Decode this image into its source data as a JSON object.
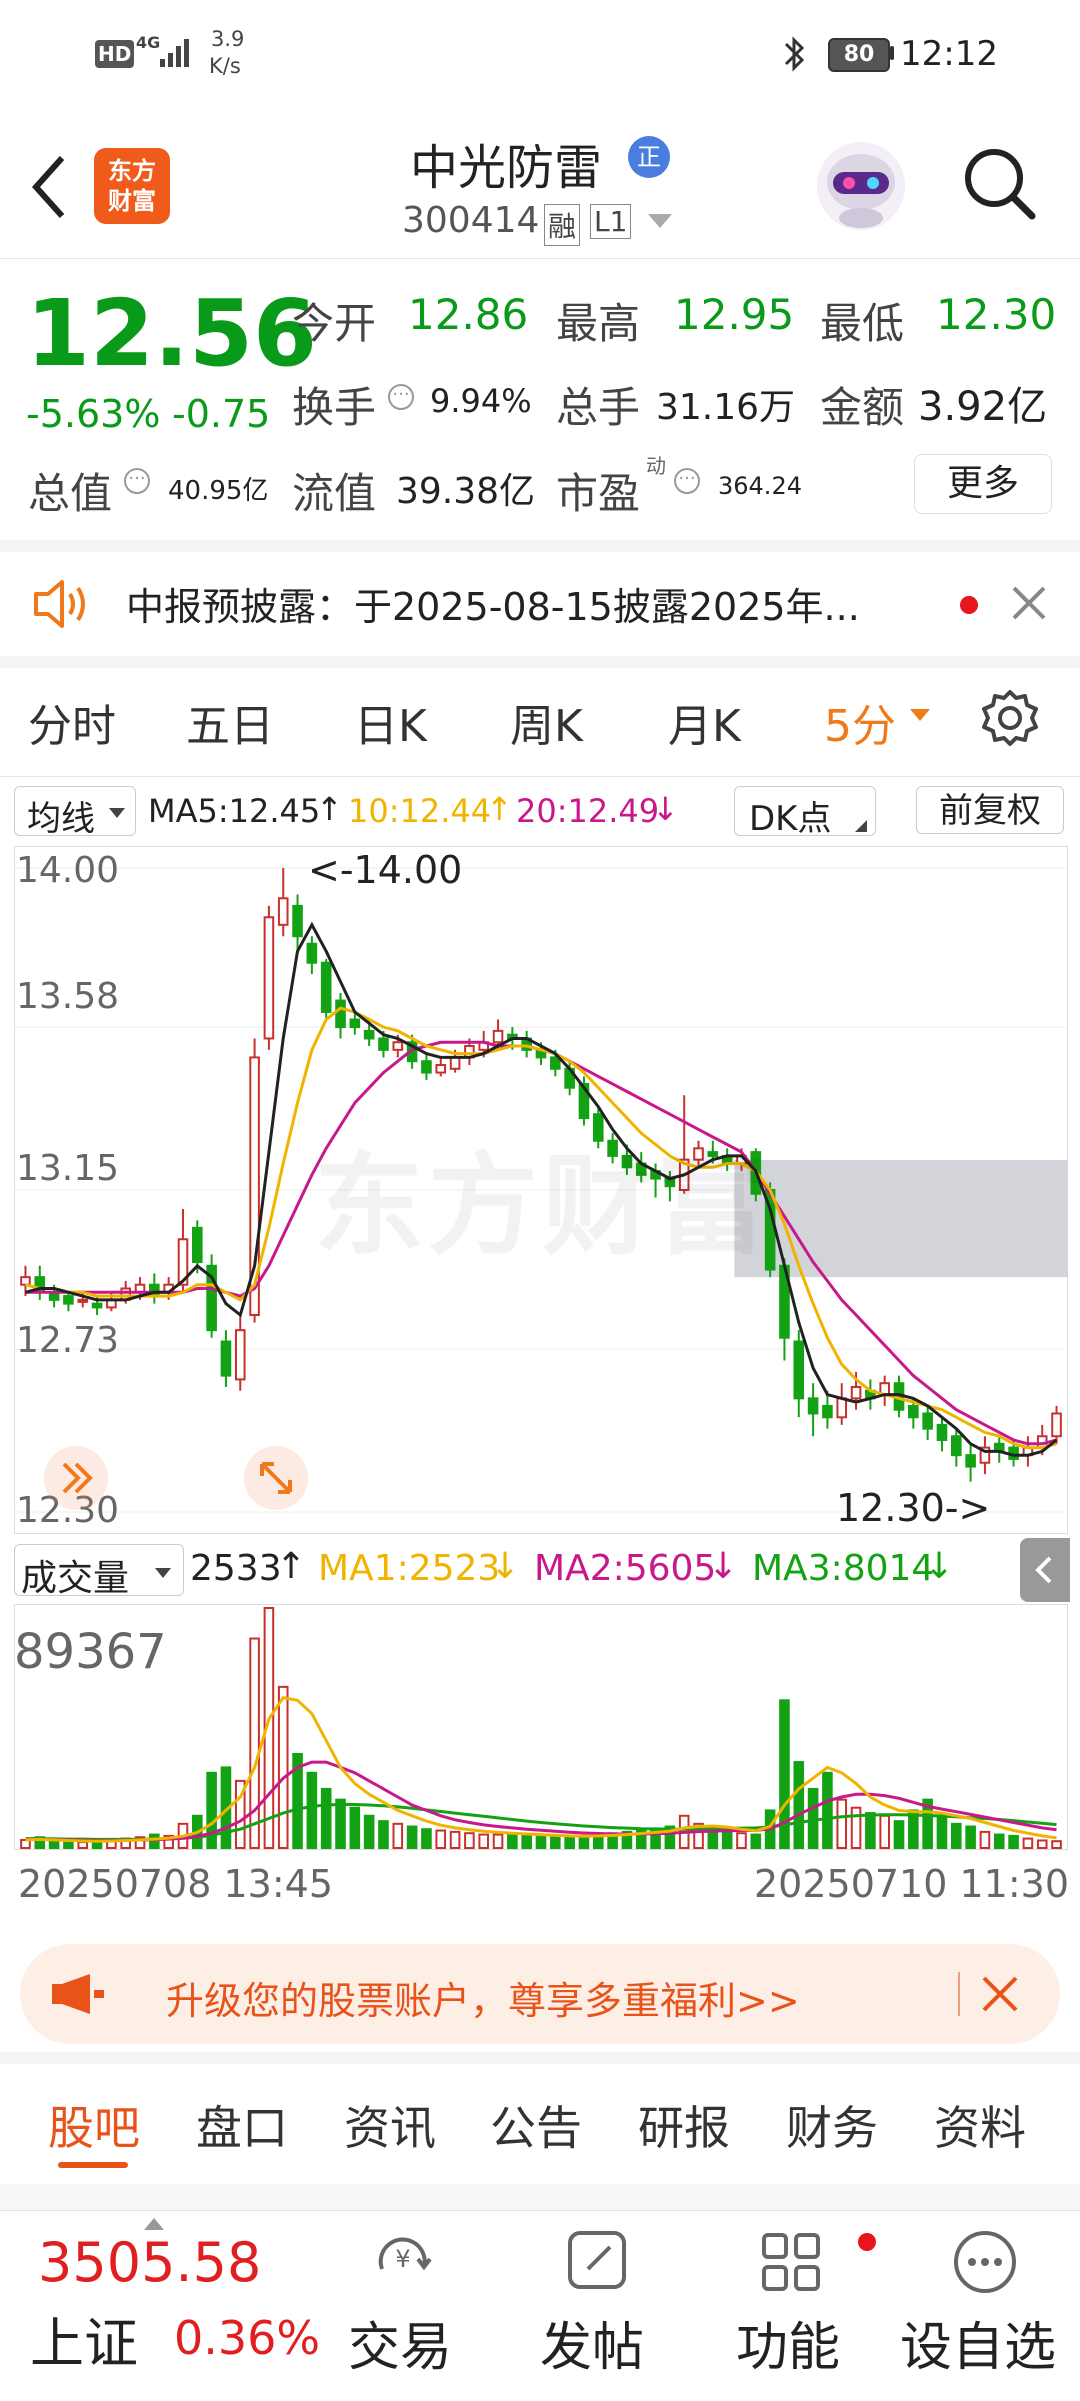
{
  "status_bar": {
    "net_speed": "3.9",
    "net_unit": "K/s",
    "battery": "80",
    "time": "12:12",
    "hd": "HD",
    "signal": "4G"
  },
  "header": {
    "logo_line1": "东方",
    "logo_line2": "财富",
    "stock_name": "中光防雷",
    "badge": "正",
    "code": "300414",
    "tag1": "融",
    "tag2": "L1"
  },
  "quote": {
    "price": "12.56",
    "pct": "-5.63%",
    "change": "-0.75",
    "open_label": "今开",
    "open": "12.86",
    "high_label": "最高",
    "high": "12.95",
    "low_label": "最低",
    "low": "12.30",
    "turnover_label": "换手",
    "turnover": "9.94%",
    "volume_label": "总手",
    "volume": "31.16万",
    "amount_label": "金额",
    "amount": "3.92亿",
    "mcap_label": "总值",
    "mcap": "40.95亿",
    "float_label": "流值",
    "float": "39.38亿",
    "pe_label": "市盈",
    "pe_sup": "动",
    "pe": "364.24",
    "more": "更多"
  },
  "notice": {
    "text": "中报预披露：于2025-08-15披露2025年..."
  },
  "period_tabs": {
    "t1": "分时",
    "t2": "五日",
    "t3": "日K",
    "t4": "周K",
    "t5": "月K",
    "t6": "5分"
  },
  "ma_bar": {
    "selector": "均线",
    "ma5": "MA5:12.45",
    "ma10": "10:12.44",
    "ma20": "20:12.49",
    "dk": "DK点",
    "fq": "前复权"
  },
  "chart_data": {
    "type": "candlestick",
    "y_ticks": [
      "14.00",
      "13.58",
      "13.15",
      "12.73",
      "12.30"
    ],
    "ylim": [
      12.3,
      14.0
    ],
    "high_marker": "<-14.00",
    "low_marker": "12.30->",
    "watermark": "东方财富",
    "opens": [
      12.9,
      12.92,
      12.88,
      12.87,
      12.86,
      12.85,
      12.84,
      12.86,
      12.88,
      12.9,
      12.88,
      12.9,
      13.05,
      12.95,
      12.75,
      12.65,
      12.82,
      13.55,
      13.85,
      13.9,
      13.8,
      13.75,
      13.65,
      13.6,
      13.57,
      13.55,
      13.52,
      13.54,
      13.49,
      13.46,
      13.47,
      13.5,
      13.52,
      13.54,
      13.56,
      13.55,
      13.52,
      13.5,
      13.47,
      13.43,
      13.35,
      13.28,
      13.24,
      13.22,
      13.2,
      13.18,
      13.15,
      13.23,
      13.25,
      13.24,
      13.22,
      13.25,
      13.15,
      12.95,
      12.75,
      12.6,
      12.58,
      12.55,
      12.6,
      12.62,
      12.61,
      12.64,
      12.58,
      12.56,
      12.53,
      12.5,
      12.45,
      12.43,
      12.48,
      12.47,
      12.45,
      12.47,
      12.5
    ],
    "closes": [
      12.92,
      12.88,
      12.86,
      12.85,
      12.86,
      12.84,
      12.86,
      12.89,
      12.9,
      12.87,
      12.9,
      13.02,
      12.96,
      12.78,
      12.66,
      12.78,
      13.5,
      13.87,
      13.92,
      13.82,
      13.75,
      13.62,
      13.58,
      13.58,
      13.55,
      13.52,
      13.54,
      13.49,
      13.46,
      13.48,
      13.5,
      13.53,
      13.54,
      13.57,
      13.55,
      13.52,
      13.5,
      13.47,
      13.42,
      13.34,
      13.28,
      13.24,
      13.21,
      13.19,
      13.18,
      13.16,
      13.23,
      13.26,
      13.24,
      13.22,
      13.24,
      13.14,
      12.94,
      12.76,
      12.6,
      12.56,
      12.55,
      12.6,
      12.63,
      12.6,
      12.64,
      12.57,
      12.55,
      12.52,
      12.49,
      12.45,
      12.42,
      12.47,
      12.46,
      12.44,
      12.47,
      12.5,
      12.56
    ],
    "highs": [
      12.95,
      12.95,
      12.9,
      12.88,
      12.88,
      12.87,
      12.88,
      12.91,
      12.92,
      12.93,
      12.92,
      13.1,
      13.07,
      12.98,
      12.78,
      12.82,
      13.55,
      13.9,
      14.0,
      13.93,
      13.82,
      13.76,
      13.67,
      13.62,
      13.6,
      13.57,
      13.56,
      13.56,
      13.51,
      13.5,
      13.52,
      13.55,
      13.57,
      13.6,
      13.58,
      13.57,
      13.54,
      13.52,
      13.49,
      13.45,
      13.37,
      13.3,
      13.27,
      13.25,
      13.22,
      13.2,
      13.4,
      13.28,
      13.28,
      13.26,
      13.26,
      13.26,
      13.17,
      12.97,
      12.78,
      12.64,
      12.62,
      12.64,
      12.67,
      12.65,
      12.66,
      12.66,
      12.6,
      12.58,
      12.55,
      12.52,
      12.48,
      12.5,
      12.5,
      12.49,
      12.5,
      12.53,
      12.58
    ],
    "lows": [
      12.87,
      12.86,
      12.84,
      12.83,
      12.84,
      12.82,
      12.83,
      12.85,
      12.86,
      12.85,
      12.86,
      12.88,
      12.93,
      12.76,
      12.63,
      12.62,
      12.8,
      13.52,
      13.82,
      13.78,
      13.72,
      13.6,
      13.55,
      13.56,
      13.53,
      13.5,
      13.5,
      13.47,
      13.44,
      13.45,
      13.46,
      13.48,
      13.5,
      13.52,
      13.52,
      13.5,
      13.48,
      13.45,
      13.4,
      13.32,
      13.26,
      13.22,
      13.19,
      13.17,
      13.13,
      13.12,
      13.14,
      13.21,
      13.22,
      13.2,
      13.2,
      13.12,
      12.92,
      12.7,
      12.55,
      12.5,
      12.52,
      12.53,
      12.57,
      12.57,
      12.58,
      12.55,
      12.52,
      12.49,
      12.46,
      12.42,
      12.38,
      12.4,
      12.43,
      12.42,
      12.42,
      12.45,
      12.48
    ],
    "ma5": [
      12.88,
      12.89,
      12.89,
      12.88,
      12.87,
      12.86,
      12.86,
      12.86,
      12.87,
      12.88,
      12.88,
      12.91,
      12.95,
      12.92,
      12.85,
      12.82,
      12.95,
      13.25,
      13.55,
      13.78,
      13.85,
      13.78,
      13.7,
      13.62,
      13.59,
      13.56,
      13.55,
      13.53,
      13.51,
      13.5,
      13.5,
      13.5,
      13.51,
      13.53,
      13.55,
      13.55,
      13.53,
      13.51,
      13.47,
      13.42,
      13.37,
      13.31,
      13.26,
      13.22,
      13.2,
      13.18,
      13.19,
      13.21,
      13.23,
      13.24,
      13.24,
      13.2,
      13.1,
      12.95,
      12.8,
      12.68,
      12.61,
      12.6,
      12.59,
      12.6,
      12.61,
      12.61,
      12.6,
      12.58,
      12.55,
      12.52,
      12.48,
      12.46,
      12.46,
      12.45,
      12.45,
      12.46,
      12.49
    ],
    "ma10": [
      12.9,
      12.89,
      12.89,
      12.88,
      12.88,
      12.87,
      12.87,
      12.87,
      12.87,
      12.87,
      12.87,
      12.88,
      12.9,
      12.9,
      12.88,
      12.86,
      12.9,
      13.05,
      13.22,
      13.38,
      13.52,
      13.6,
      13.63,
      13.62,
      13.6,
      13.58,
      13.57,
      13.55,
      13.53,
      13.52,
      13.51,
      13.51,
      13.51,
      13.52,
      13.53,
      13.53,
      13.52,
      13.51,
      13.49,
      13.46,
      13.42,
      13.38,
      13.34,
      13.3,
      13.27,
      13.24,
      13.22,
      13.21,
      13.21,
      13.22,
      13.22,
      13.2,
      13.15,
      13.06,
      12.95,
      12.85,
      12.76,
      12.69,
      12.65,
      12.62,
      12.61,
      12.6,
      12.59,
      12.58,
      12.57,
      12.55,
      12.53,
      12.51,
      12.5,
      12.48,
      12.47,
      12.47,
      12.48
    ],
    "ma20": [
      12.88,
      12.88,
      12.88,
      12.88,
      12.88,
      12.88,
      12.88,
      12.88,
      12.88,
      12.88,
      12.88,
      12.88,
      12.89,
      12.89,
      12.88,
      12.87,
      12.89,
      12.95,
      13.03,
      13.11,
      13.19,
      13.26,
      13.32,
      13.38,
      13.42,
      13.46,
      13.49,
      13.52,
      13.53,
      13.54,
      13.54,
      13.54,
      13.54,
      13.53,
      13.53,
      13.53,
      13.52,
      13.51,
      13.49,
      13.47,
      13.45,
      13.43,
      13.41,
      13.39,
      13.37,
      13.35,
      13.33,
      13.31,
      13.29,
      13.27,
      13.25,
      13.2,
      13.14,
      13.08,
      13.02,
      12.96,
      12.91,
      12.86,
      12.82,
      12.78,
      12.74,
      12.7,
      12.66,
      12.63,
      12.6,
      12.57,
      12.55,
      12.53,
      12.51,
      12.49,
      12.48,
      12.48,
      12.49
    ]
  },
  "volume_bar": {
    "selector": "成交量",
    "current": "2533",
    "ma1": "MA1:2523",
    "ma2": "MA2:5605",
    "ma3": "MA3:8014",
    "max_label": "89367"
  },
  "volume_data": {
    "max": 89367,
    "values": [
      3000,
      4000,
      2500,
      2000,
      2200,
      2500,
      3000,
      3500,
      4000,
      5000,
      4500,
      9000,
      12000,
      28000,
      30000,
      25000,
      78000,
      89367,
      60000,
      35000,
      28000,
      22000,
      18000,
      15000,
      12000,
      10000,
      9000,
      8000,
      7000,
      6500,
      6000,
      5500,
      5000,
      5000,
      5000,
      4500,
      4500,
      4000,
      4000,
      4500,
      5000,
      5500,
      6000,
      6500,
      7000,
      8000,
      12000,
      9000,
      7000,
      6000,
      5500,
      5000,
      14000,
      55000,
      32000,
      22000,
      28000,
      18000,
      15000,
      13000,
      12000,
      10000,
      14000,
      18000,
      12000,
      9000,
      8000,
      6000,
      5000,
      4500,
      3500,
      2800,
      2533
    ],
    "ma1": [
      3000,
      3200,
      3000,
      2800,
      2600,
      2500,
      2600,
      2800,
      3000,
      3300,
      3700,
      4400,
      5800,
      9000,
      14000,
      19000,
      30000,
      48000,
      56000,
      55000,
      50000,
      40000,
      30000,
      24000,
      20000,
      17000,
      14000,
      12000,
      10000,
      8500,
      7500,
      6800,
      6200,
      5800,
      5500,
      5200,
      5000,
      4700,
      4500,
      4400,
      4500,
      4700,
      5000,
      5400,
      5800,
      6300,
      7500,
      8000,
      8200,
      7800,
      7000,
      6400,
      8000,
      16000,
      22000,
      26000,
      30000,
      28000,
      24000,
      19000,
      16000,
      14000,
      13500,
      13500,
      13000,
      12000,
      11000,
      9500,
      8000,
      6500,
      5500,
      4500,
      3800
    ],
    "ma2": [
      3200,
      3200,
      3100,
      3000,
      2900,
      2800,
      2800,
      2900,
      3000,
      3100,
      3300,
      3700,
      4300,
      5500,
      7500,
      10000,
      14000,
      20000,
      26000,
      30000,
      32000,
      32000,
      30000,
      28000,
      25000,
      22000,
      19000,
      16000,
      14000,
      12000,
      10500,
      9500,
      8600,
      8000,
      7500,
      7000,
      6600,
      6200,
      5900,
      5600,
      5400,
      5200,
      5200,
      5200,
      5300,
      5500,
      5800,
      6100,
      6300,
      6400,
      6500,
      6500,
      7200,
      9500,
      12500,
      15000,
      17500,
      19000,
      20000,
      20000,
      19500,
      18500,
      17000,
      15500,
      14500,
      13500,
      12500,
      11500,
      10500,
      9500,
      8500,
      7500,
      6800
    ],
    "ma3": [
      3500,
      3500,
      3400,
      3300,
      3300,
      3200,
      3200,
      3200,
      3200,
      3300,
      3400,
      3600,
      4000,
      4800,
      5800,
      7000,
      9000,
      11000,
      13000,
      14500,
      15500,
      16000,
      16200,
      16200,
      16000,
      15700,
      15300,
      14800,
      14200,
      13600,
      13000,
      12400,
      11800,
      11200,
      10600,
      10000,
      9500,
      9000,
      8600,
      8200,
      7900,
      7600,
      7400,
      7200,
      7100,
      7000,
      7000,
      7100,
      7200,
      7300,
      7400,
      7500,
      7800,
      8600,
      9500,
      10300,
      11000,
      11600,
      12000,
      12300,
      12400,
      12400,
      12300,
      12100,
      11900,
      11600,
      11300,
      11000,
      10600,
      10200,
      9700,
      9200,
      8700
    ]
  },
  "time_axis": {
    "start": "20250708 13:45",
    "end": "20250710 11:30"
  },
  "promo": {
    "text": "升级您的股票账户，尊享多重福利>>"
  },
  "section_tabs": {
    "t1": "股吧",
    "t2": "盘口",
    "t3": "资讯",
    "t4": "公告",
    "t5": "研报",
    "t6": "财务",
    "t7": "资料"
  },
  "bottom_bar": {
    "index_value": "3505.58",
    "index_name": "上证",
    "index_pct": "0.36%",
    "b1": "交易",
    "b2": "发帖",
    "b3": "功能",
    "b4": "设自选"
  },
  "colors": {
    "up": "#c8302c",
    "down": "#13a214",
    "ma5": "#222222",
    "ma10": "#f0b400",
    "ma20": "#c8188a",
    "accent": "#f07a1a"
  }
}
